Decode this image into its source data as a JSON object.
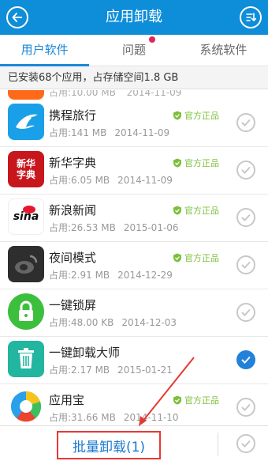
{
  "header": {
    "title": "应用卸载",
    "back_icon": "back-arrow-icon",
    "sort_icon": "sort-download-icon",
    "bg_color": "#0e8dd9"
  },
  "tabs": [
    {
      "label": "用户软件",
      "active": true
    },
    {
      "label": "问题",
      "active": false,
      "has_badge": true
    },
    {
      "label": "系统软件",
      "active": false
    }
  ],
  "summary": "已安装68个应用，占存储空间1.8 GB",
  "partial_row": {
    "meta": "占用:10.00 MB",
    "date": "2014-11-09"
  },
  "apps": [
    {
      "name": "携程旅行",
      "size": "占用:141 MB",
      "date": "2014-11-09",
      "official": "官方正品",
      "checked": false,
      "icon": "ctrip-dolphin-icon"
    },
    {
      "name": "新华字典",
      "size": "占用:6.05 MB",
      "date": "2014-11-09",
      "official": "官方正品",
      "checked": false,
      "icon": "xinhua-dictionary-icon",
      "icon_text": "新华字典"
    },
    {
      "name": "新浪新闻",
      "size": "占用:26.53 MB",
      "date": "2015-01-06",
      "official": "官方正品",
      "checked": false,
      "icon": "sina-eye-icon",
      "icon_text": "sina"
    },
    {
      "name": "夜间模式",
      "size": "占用:2.91 MB",
      "date": "2014-12-29",
      "official": "官方正品",
      "checked": false,
      "icon": "weibo-night-icon"
    },
    {
      "name": "一键锁屏",
      "size": "占用:48.00 KB",
      "date": "2014-12-03",
      "official": "",
      "checked": false,
      "icon": "lock-icon"
    },
    {
      "name": "一键卸载大师",
      "size": "占用:2.17 MB",
      "date": "2015-01-21",
      "official": "",
      "checked": true,
      "icon": "trash-icon"
    },
    {
      "name": "应用宝",
      "size": "占用:31.66 MB",
      "date": "2014-11-10",
      "official": "官方正品",
      "checked": false,
      "icon": "yingyongbao-icon"
    }
  ],
  "bottom": {
    "batch_label": "批量卸载(1)"
  }
}
